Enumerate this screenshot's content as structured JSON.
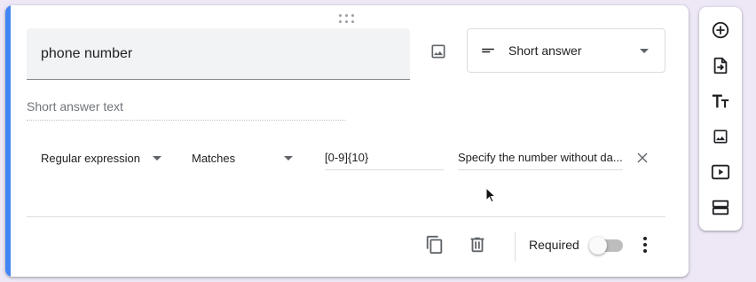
{
  "question": {
    "title_value": "phone number",
    "type_label": "Short answer",
    "answer_placeholder": "Short answer text"
  },
  "validation": {
    "kind_label": "Regular expression",
    "condition_label": "Matches",
    "pattern_value": "[0-9]{10}",
    "error_text_value": "Specify the number without da..."
  },
  "footer": {
    "required_label": "Required",
    "required_enabled": false
  },
  "toolbar": {
    "items": [
      "add-question-icon",
      "import-questions-icon",
      "add-title-icon",
      "add-image-icon",
      "add-video-icon",
      "add-section-icon"
    ]
  },
  "colors": {
    "accent": "#4285f4",
    "background": "#ede7f6"
  }
}
